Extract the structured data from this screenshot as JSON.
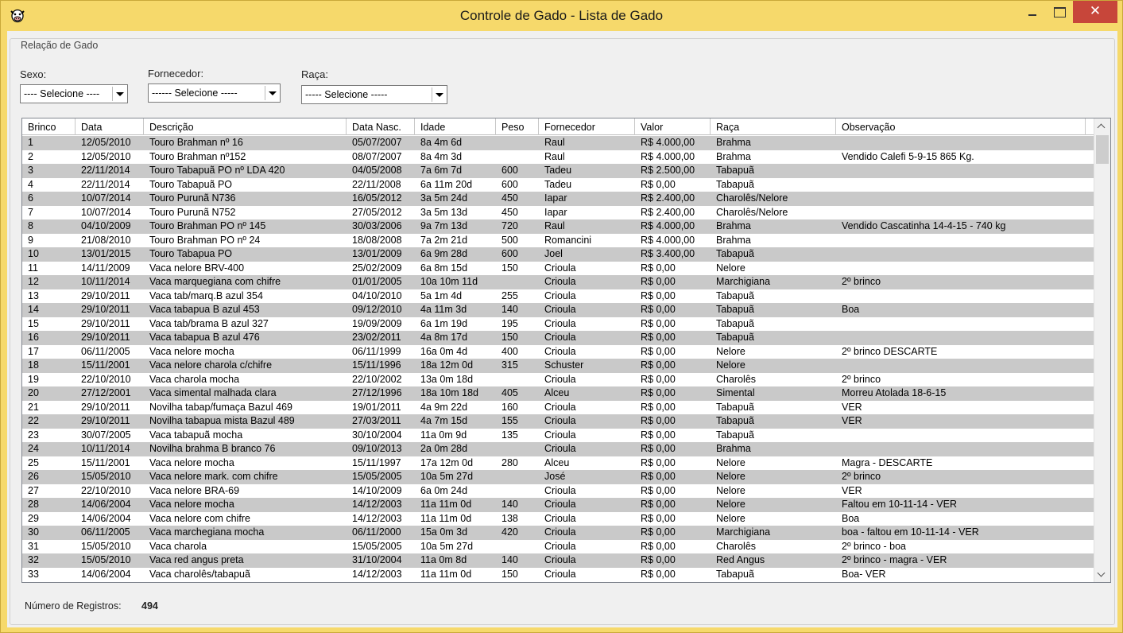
{
  "window": {
    "title": "Controle de Gado - Lista de Gado",
    "close_symbol": "✕",
    "app_icon": "cow-icon",
    "titlebar_color": "#f6d96b",
    "close_color": "#c7463a"
  },
  "group": {
    "title": "Relação de Gado"
  },
  "filters": {
    "sexo": {
      "label": "Sexo:",
      "value": "---- Selecione ----"
    },
    "fornecedor": {
      "label": "Fornecedor:",
      "value": "------ Selecione -----"
    },
    "raca": {
      "label": "Raça:",
      "value": "----- Selecione -----"
    }
  },
  "table": {
    "columns": [
      "Brinco",
      "Data",
      "Descrição",
      "Data Nasc.",
      "Idade",
      "Peso",
      "Fornecedor",
      "Valor",
      "Raça",
      "Observação"
    ],
    "alt_row_color": "#c9c9c9",
    "rows": [
      [
        "1",
        "12/05/2010",
        "Touro Brahman nº 16",
        "05/07/2007",
        "8a 4m 6d",
        "",
        "Raul",
        "R$ 4.000,00",
        "Brahma",
        ""
      ],
      [
        "2",
        "12/05/2010",
        "Touro Brahman nº152",
        "08/07/2007",
        "8a 4m 3d",
        "",
        "Raul",
        "R$ 4.000,00",
        "Brahma",
        "Vendido Calefi 5-9-15 865 Kg."
      ],
      [
        "3",
        "22/11/2014",
        "Touro Tabapuã PO nº LDA 420",
        "04/05/2008",
        "7a 6m 7d",
        "600",
        "Tadeu",
        "R$ 2.500,00",
        "Tabapuã",
        ""
      ],
      [
        "4",
        "22/11/2014",
        "Touro Tabapuã PO",
        "22/11/2008",
        "6a 11m 20d",
        "600",
        "Tadeu",
        "R$ 0,00",
        "Tabapuã",
        ""
      ],
      [
        "6",
        "10/07/2014",
        "Touro Purunã N736",
        "16/05/2012",
        "3a 5m 24d",
        "450",
        "Iapar",
        "R$ 2.400,00",
        "Charolês/Nelore",
        ""
      ],
      [
        "7",
        "10/07/2014",
        "Touro Purunã N752",
        "27/05/2012",
        "3a 5m 13d",
        "450",
        "Iapar",
        "R$ 2.400,00",
        "Charolês/Nelore",
        ""
      ],
      [
        "8",
        "04/10/2009",
        "Touro Brahman PO nº 145",
        "30/03/2006",
        "9a 7m 13d",
        "720",
        "Raul",
        "R$ 4.000,00",
        "Brahma",
        "Vendido Cascatinha 14-4-15  - 740 kg"
      ],
      [
        "9",
        "21/08/2010",
        "Touro Brahman PO nº 24",
        "18/08/2008",
        "7a 2m 21d",
        "500",
        "Romancini",
        "R$ 4.000,00",
        "Brahma",
        ""
      ],
      [
        "10",
        "13/01/2015",
        "Touro Tabapua PO",
        "13/01/2009",
        "6a 9m 28d",
        "600",
        "Joel",
        "R$ 3.400,00",
        "Tabapuã",
        ""
      ],
      [
        "11",
        "14/11/2009",
        "Vaca nelore BRV-400",
        "25/02/2009",
        "6a 8m 15d",
        "150",
        "Crioula",
        "R$ 0,00",
        "Nelore",
        ""
      ],
      [
        "12",
        "10/11/2014",
        "Vaca marquegiana com chifre",
        "01/01/2005",
        "10a 10m 11d",
        "",
        "Crioula",
        "R$ 0,00",
        "Marchigiana",
        "2º brinco"
      ],
      [
        "13",
        "29/10/2011",
        "Vaca tab/marq.B azul 354",
        "04/10/2010",
        "5a 1m 4d",
        "255",
        "Crioula",
        "R$ 0,00",
        "Tabapuã",
        ""
      ],
      [
        "14",
        "29/10/2011",
        "Vaca tabapua B azul 453",
        "09/12/2010",
        "4a 11m 3d",
        "140",
        "Crioula",
        "R$ 0,00",
        "Tabapuã",
        "Boa"
      ],
      [
        "15",
        "29/10/2011",
        "Vaca tab/brama B azul 327",
        "19/09/2009",
        "6a 1m 19d",
        "195",
        "Crioula",
        "R$ 0,00",
        "Tabapuã",
        ""
      ],
      [
        "16",
        "29/10/2011",
        "Vaca tabapua B azul 476",
        "23/02/2011",
        "4a 8m 17d",
        "150",
        "Crioula",
        "R$ 0,00",
        "Tabapuã",
        ""
      ],
      [
        "17",
        "06/11/2005",
        "Vaca nelore mocha",
        "06/11/1999",
        "16a 0m 4d",
        "400",
        "Crioula",
        "R$ 0,00",
        "Nelore",
        "2º brinco DESCARTE"
      ],
      [
        "18",
        "15/11/2001",
        "Vaca nelore charola c/chifre",
        "15/11/1996",
        "18a 12m 0d",
        "315",
        "Schuster",
        "R$ 0,00",
        "Nelore",
        ""
      ],
      [
        "19",
        "22/10/2010",
        "Vaca charola mocha",
        "22/10/2002",
        "13a 0m 18d",
        "",
        "Crioula",
        "R$ 0,00",
        "Charolês",
        "2º brinco"
      ],
      [
        "20",
        "27/12/2001",
        "Vaca simental malhada clara",
        "27/12/1996",
        "18a 10m 18d",
        "405",
        "Alceu",
        "R$ 0,00",
        "Simental",
        "Morreu Atolada 18-6-15"
      ],
      [
        "21",
        "29/10/2011",
        "Novilha tabap/fumaça Bazul 469",
        "19/01/2011",
        "4a 9m 22d",
        "160",
        "Crioula",
        "R$ 0,00",
        "Tabapuã",
        "VER"
      ],
      [
        "22",
        "29/10/2011",
        "Novilha tabapua mista Bazul 489",
        "27/03/2011",
        "4a 7m 15d",
        "155",
        "Crioula",
        "R$ 0,00",
        "Tabapuã",
        "VER"
      ],
      [
        "23",
        "30/07/2005",
        "Vaca tabapuã mocha",
        "30/10/2004",
        "11a 0m 9d",
        "135",
        "Crioula",
        "R$ 0,00",
        "Tabapuã",
        ""
      ],
      [
        "24",
        "10/11/2014",
        "Novilha brahma B branco 76",
        "09/10/2013",
        "2a 0m 28d",
        "",
        "Crioula",
        "R$ 0,00",
        "Brahma",
        ""
      ],
      [
        "25",
        "15/11/2001",
        "Vaca nelore mocha",
        "15/11/1997",
        "17a 12m 0d",
        "280",
        "Alceu",
        "R$ 0,00",
        "Nelore",
        "Magra - DESCARTE"
      ],
      [
        "26",
        "15/05/2010",
        "Vaca nelore mark. com chifre",
        "15/05/2005",
        "10a 5m 27d",
        "",
        "José",
        "R$ 0,00",
        "Nelore",
        "2º brinco"
      ],
      [
        "27",
        "22/10/2010",
        "Vaca nelore BRA-69",
        "14/10/2009",
        "6a 0m 24d",
        "",
        "Crioula",
        "R$ 0,00",
        "Nelore",
        "VER"
      ],
      [
        "28",
        "14/06/2004",
        "Vaca nelore mocha",
        "14/12/2003",
        "11a 11m 0d",
        "140",
        "Crioula",
        "R$ 0,00",
        "Nelore",
        "Faltou em 10-11-14 - VER"
      ],
      [
        "29",
        "14/06/2004",
        "Vaca nelore com chifre",
        "14/12/2003",
        "11a 11m 0d",
        "138",
        "Crioula",
        "R$ 0,00",
        "Nelore",
        "Boa"
      ],
      [
        "30",
        "06/11/2005",
        "Vaca marchegiana mocha",
        "06/11/2000",
        "15a 0m 3d",
        "420",
        "Crioula",
        "R$ 0,00",
        "Marchigiana",
        "boa - faltou em 10-11-14 - VER"
      ],
      [
        "31",
        "15/05/2010",
        "Vaca charola",
        "15/05/2005",
        "10a 5m 27d",
        "",
        "Crioula",
        "R$ 0,00",
        "Charolês",
        "2º brinco - boa"
      ],
      [
        "32",
        "15/05/2010",
        "Vaca red angus preta",
        "31/10/2004",
        "11a 0m 8d",
        "140",
        "Crioula",
        "R$ 0,00",
        "Red Angus",
        "2º brinco - magra - VER"
      ],
      [
        "33",
        "14/06/2004",
        "Vaca charolês/tabapuã",
        "14/12/2003",
        "11a 11m 0d",
        "150",
        "Crioula",
        "R$ 0,00",
        "Tabapuã",
        "Boa- VER"
      ]
    ]
  },
  "footer": {
    "count_label": "Número de Registros:",
    "count_value": "494"
  }
}
